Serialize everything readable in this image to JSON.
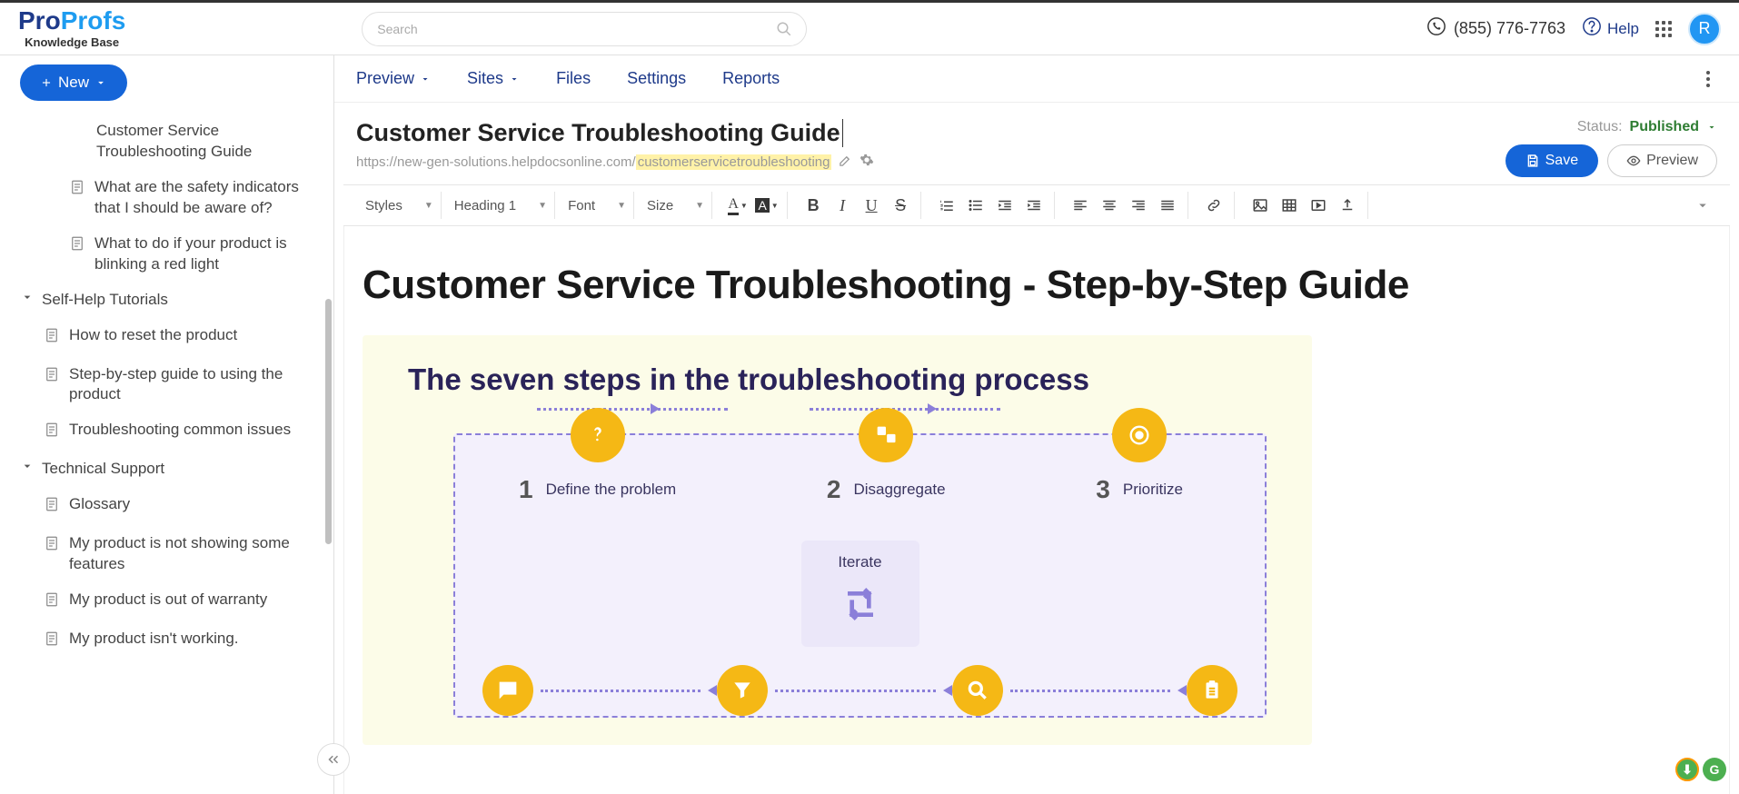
{
  "header": {
    "logo_main_pro": "Pro",
    "logo_main_profs": "Profs",
    "logo_sub": "Knowledge Base",
    "search_placeholder": "Search",
    "phone": "(855) 776-7763",
    "help": "Help",
    "avatar_letter": "R"
  },
  "sidebar": {
    "new_btn": "New",
    "items": [
      {
        "label": "Customer Service Troubleshooting Guide",
        "level": "grandchild",
        "icon": false
      },
      {
        "label": "What are the safety indicators that I should be aware of?",
        "level": "child",
        "icon": true
      },
      {
        "label": "What to do if your product is blinking a red light",
        "level": "child",
        "icon": true
      }
    ],
    "cat_self_help": "Self-Help Tutorials",
    "self_help_items": [
      {
        "label": "How to reset the product"
      },
      {
        "label": "Step-by-step guide to using the product"
      },
      {
        "label": "Troubleshooting common issues"
      }
    ],
    "cat_tech": "Technical Support",
    "tech_items": [
      {
        "label": "Glossary"
      },
      {
        "label": "My product is not showing some features"
      },
      {
        "label": "My product is out of warranty"
      },
      {
        "label": "My product isn't working."
      }
    ]
  },
  "tabs": {
    "preview": "Preview",
    "sites": "Sites",
    "files": "Files",
    "settings": "Settings",
    "reports": "Reports"
  },
  "page": {
    "title": "Customer Service Troubleshooting Guide",
    "url_base": "https://new-gen-solutions.helpdocsonline.com/",
    "url_slug": "customerservicetroubleshooting",
    "status_label": "Status:",
    "status_value": "Published",
    "save": "Save",
    "preview": "Preview"
  },
  "toolbar": {
    "styles": "Styles",
    "heading": "Heading 1",
    "font": "Font",
    "size": "Size"
  },
  "content": {
    "heading": "Customer Service Troubleshooting - Step-by-Step Guide",
    "info_title": "The seven steps in the troubleshooting process",
    "step1_num": "1",
    "step1_text": "Define the problem",
    "step2_num": "2",
    "step2_text": "Disaggregate",
    "step3_num": "3",
    "step3_text": "Prioritize",
    "iterate": "Iterate"
  }
}
